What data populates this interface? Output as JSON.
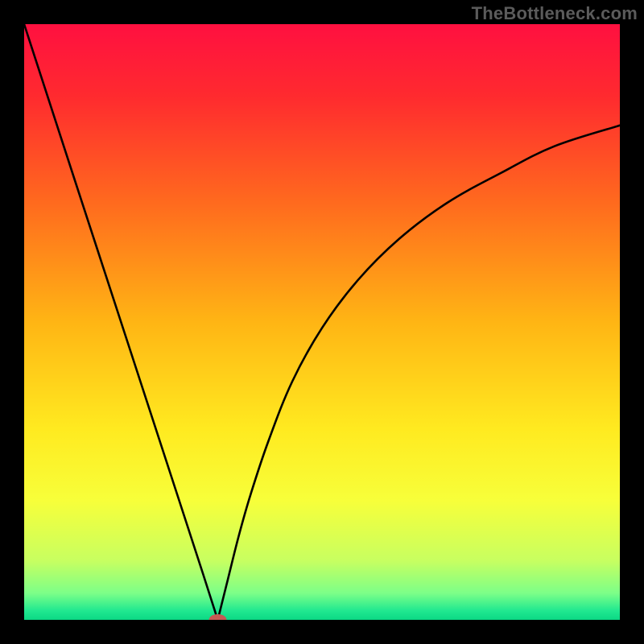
{
  "watermark": "TheBottleneck.com",
  "chart_data": {
    "type": "line",
    "title": "",
    "xlabel": "",
    "ylabel": "",
    "xlim": [
      0,
      100
    ],
    "ylim": [
      0,
      100
    ],
    "grid": false,
    "legend": false,
    "background_gradient_stops": [
      {
        "offset": 0.0,
        "color": "#ff1040"
      },
      {
        "offset": 0.12,
        "color": "#ff2a2f"
      },
      {
        "offset": 0.3,
        "color": "#ff6a1e"
      },
      {
        "offset": 0.5,
        "color": "#ffb514"
      },
      {
        "offset": 0.68,
        "color": "#ffea20"
      },
      {
        "offset": 0.8,
        "color": "#f7ff3a"
      },
      {
        "offset": 0.9,
        "color": "#c8ff60"
      },
      {
        "offset": 0.955,
        "color": "#7dff88"
      },
      {
        "offset": 0.985,
        "color": "#20e890"
      },
      {
        "offset": 1.0,
        "color": "#0bd884"
      }
    ],
    "series": [
      {
        "name": "left-branch",
        "x": [
          0,
          8.7,
          17.4,
          26.1,
          30.0,
          31.6,
          32.5
        ],
        "y": [
          100,
          73.2,
          46.5,
          19.8,
          7.8,
          2.8,
          0
        ]
      },
      {
        "name": "right-branch",
        "x": [
          32.5,
          34,
          36,
          38,
          41,
          45,
          50,
          56,
          63,
          71,
          80,
          89,
          100
        ],
        "y": [
          0,
          6,
          14,
          21,
          30,
          40,
          49,
          57,
          64,
          70,
          75,
          79.5,
          83
        ]
      }
    ],
    "marker": {
      "name": "minimum-marker",
      "x": 32.5,
      "y": 0,
      "color": "#c65a54",
      "rx": 11,
      "ry": 7
    }
  }
}
